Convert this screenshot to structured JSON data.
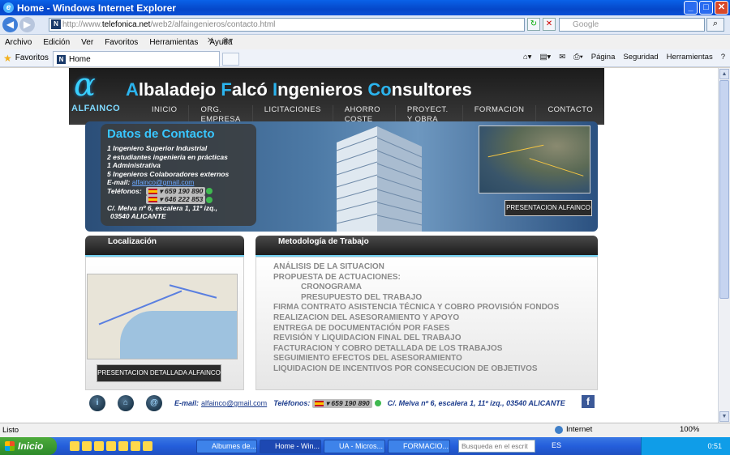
{
  "window": {
    "title": "Home - Windows Internet Explorer",
    "buttons": [
      "_",
      "□",
      "✕"
    ]
  },
  "addressbar": {
    "url_prefix": "http://www.",
    "url_domain": "telefonica.net",
    "url_suffix": "/web2/alfaingenieros/contacto.html",
    "search_placeholder": "Google"
  },
  "menu": [
    "Archivo",
    "Edición",
    "Ver",
    "Favoritos",
    "Herramientas",
    "Ayuda"
  ],
  "favorites": {
    "label": "Favoritos",
    "tab_title": "Home"
  },
  "commandbar": [
    "Página",
    "Seguridad",
    "Herramientas",
    "?"
  ],
  "site": {
    "logo_alpha": "α",
    "logo_text": "ALFAINCO",
    "title_parts": [
      {
        "text": "A",
        "accent": true
      },
      {
        "text": "lbaladejo ",
        "accent": false
      },
      {
        "text": "F",
        "accent": true
      },
      {
        "text": "alcó ",
        "accent": false
      },
      {
        "text": "I",
        "accent": true
      },
      {
        "text": "ngenieros ",
        "accent": false
      },
      {
        "text": "Co",
        "accent": true
      },
      {
        "text": "nsultores",
        "accent": false
      }
    ],
    "nav": [
      "INICIO",
      "ORG. EMPRESA",
      "LICITACIONES",
      "AHORRO COSTE",
      "PROYECT. Y OBRA",
      "FORMACION",
      "CONTACTO"
    ],
    "contact": {
      "title": "Datos de Contacto",
      "lines": [
        "1 Ingeniero Superior Industrial",
        "2 estudiantes ingeniería en prácticas",
        "1 Administrativa",
        "5 Ingenieros Colaboradores externos"
      ],
      "email_label": "E-mail:",
      "email": "alfainco@gmail.com",
      "phones_label": "Teléfonos:",
      "phone1": "659 190 890",
      "phone2": "646 222 853",
      "address_line1": "C/. Melva nº 6, escalera 1, 11º izq.,",
      "address_line2": "03540 ALICANTE"
    },
    "presentation_button": "PRESENTACION ALFAINCO",
    "localizacion_title": "Localización",
    "detailed_button": "PRESENTACION DETALLADA ALFAINCO",
    "metodologia_title": "Metodología de Trabajo",
    "method_items": [
      {
        "text": "ANÁLISIS DE LA SITUACION",
        "sub": false
      },
      {
        "text": "PROPUESTA DE ACTUACIONES:",
        "sub": false
      },
      {
        "text": "CRONOGRAMA",
        "sub": true
      },
      {
        "text": "PRESUPUESTO DEL TRABAJO",
        "sub": true
      },
      {
        "text": "FIRMA CONTRATO ASISTENCIA TÉCNICA Y COBRO PROVISIÓN FONDOS",
        "sub": false
      },
      {
        "text": "REALIZACION DEL ASESORAMIENTO Y APOYO",
        "sub": false
      },
      {
        "text": "ENTREGA DE DOCUMENTACIÓN POR FASES",
        "sub": false
      },
      {
        "text": "REVISIÓN Y LIQUIDACION FINAL DEL TRABAJO",
        "sub": false
      },
      {
        "text": "FACTURACION Y COBRO DETALLADA DE LOS TRABAJOS",
        "sub": false
      },
      {
        "text": "SEGUIMIENTO EFECTOS DEL ASESORAMIENTO",
        "sub": false
      },
      {
        "text": "LIQUIDACION DE INCENTIVOS POR CONSECUCION DE OBJETIVOS",
        "sub": false
      }
    ],
    "footer": {
      "email_label": "E-mail:",
      "email": "alfainco@gmail.com",
      "phones_label": "Teléfonos:",
      "phone": "659 190 890",
      "address": "C/. Melva nº 6, escalera 1, 11º izq., 03540 ALICANTE",
      "fb": "f"
    }
  },
  "status": {
    "left": "Listo",
    "zone": "Internet",
    "zoom": "100%"
  },
  "taskbar": {
    "start": "Inicio",
    "items": [
      "Albumes de...",
      "Home - Win...",
      "UA - Micros...",
      "FORMACIO..."
    ],
    "search_placeholder": "Busqueda en el escrit",
    "lang": "ES",
    "clock": "0:51"
  },
  "colors": {
    "accent": "#2bb4ee",
    "title_bar": "#0a62e8",
    "method_text": "#8a8a8a"
  }
}
